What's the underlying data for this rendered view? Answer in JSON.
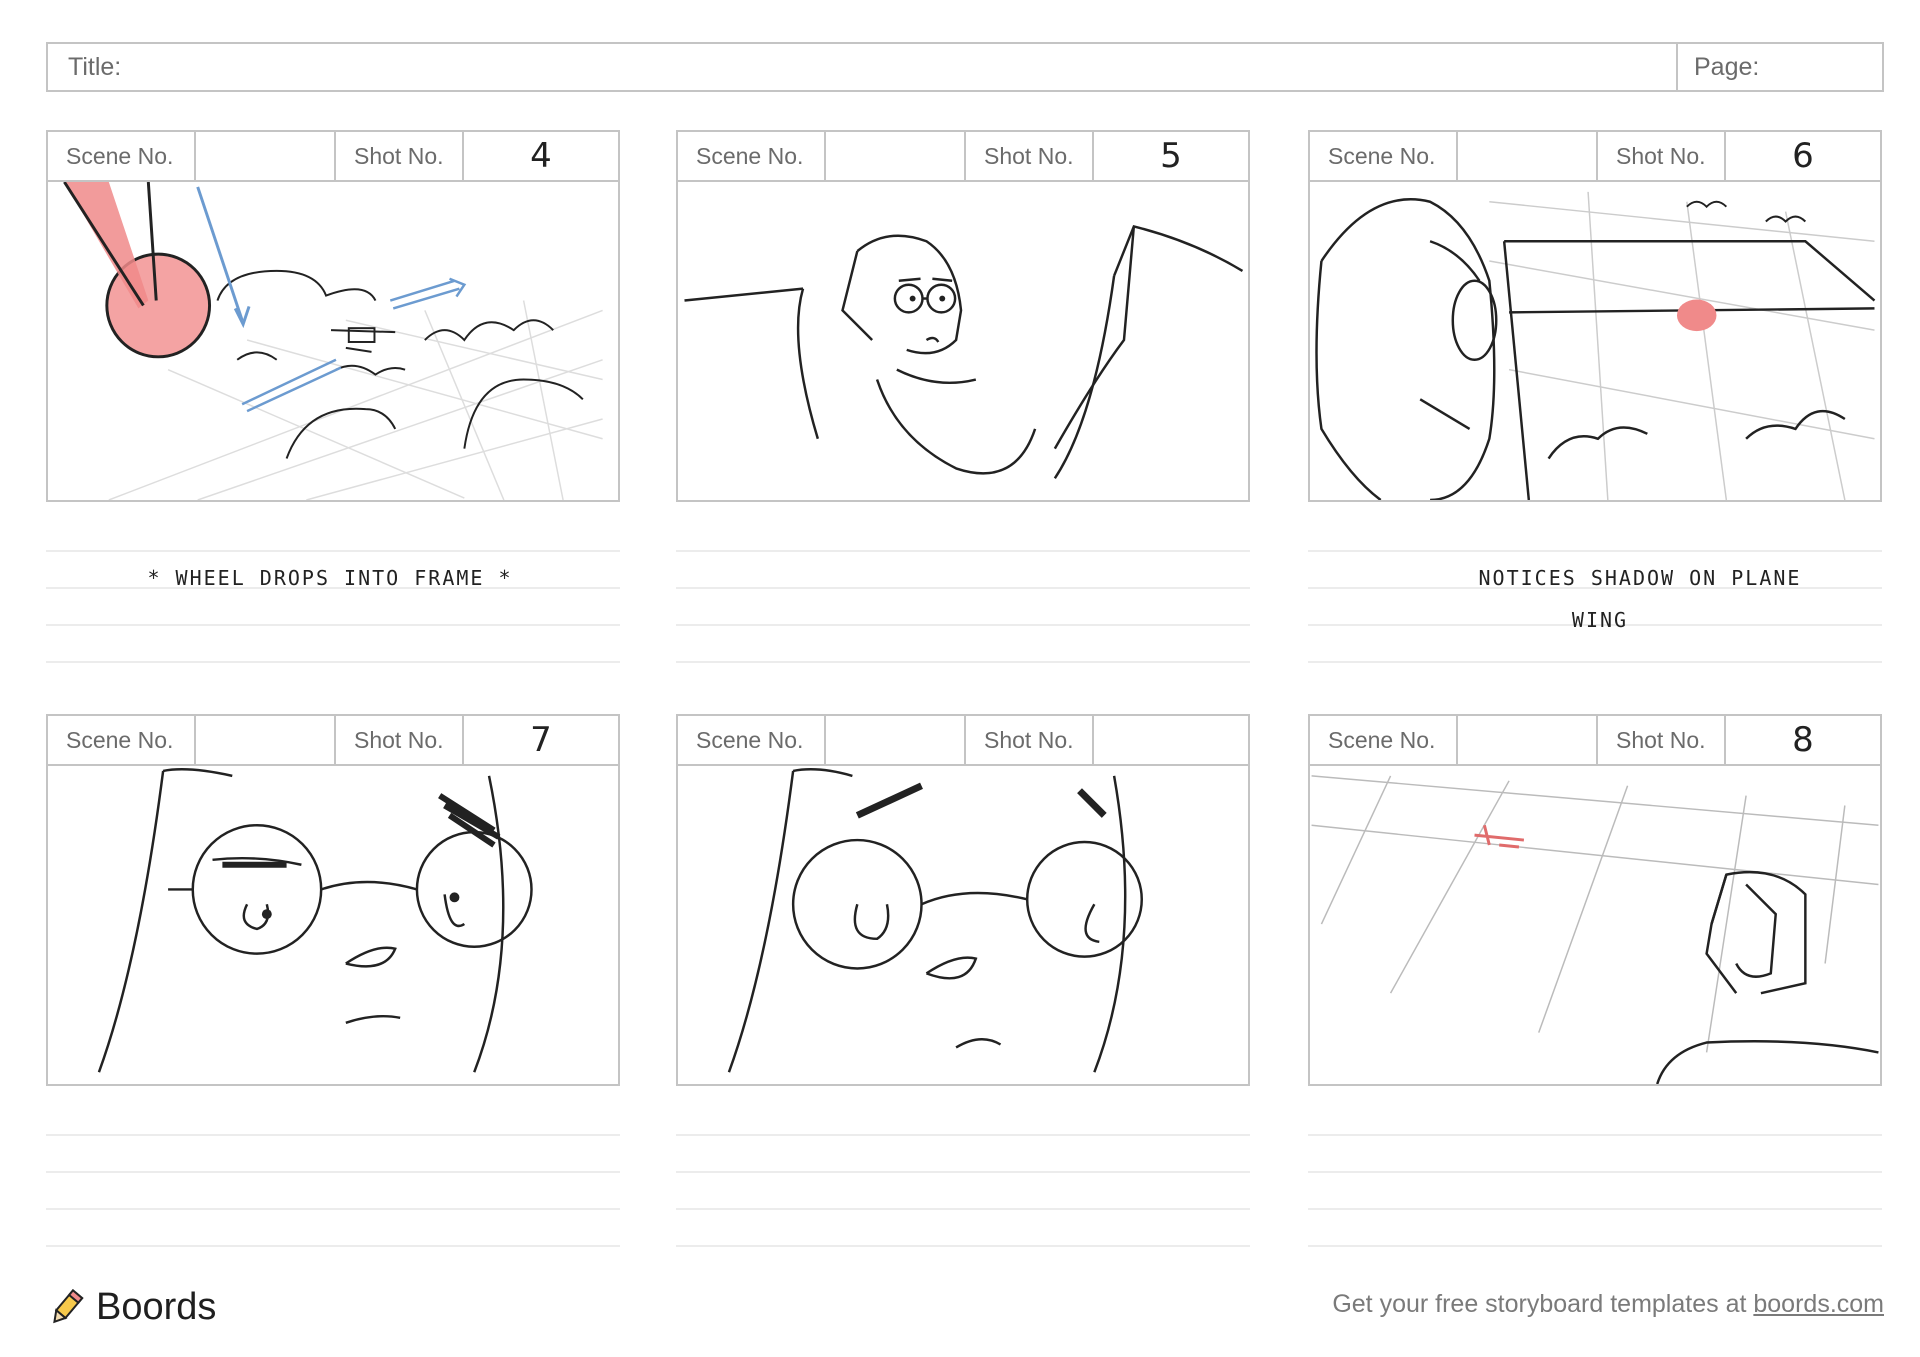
{
  "header": {
    "title_label": "Title:",
    "page_label": "Page:"
  },
  "panels": [
    {
      "scene_label": "Scene No.",
      "scene_value": "",
      "shot_label": "Shot No.",
      "shot_value": "4"
    },
    {
      "scene_label": "Scene No.",
      "scene_value": "",
      "shot_label": "Shot No.",
      "shot_value": "5"
    },
    {
      "scene_label": "Scene No.",
      "scene_value": "",
      "shot_label": "Shot No.",
      "shot_value": "6"
    },
    {
      "scene_label": "Scene No.",
      "scene_value": "",
      "shot_label": "Shot No.",
      "shot_value": "7"
    },
    {
      "scene_label": "Scene No.",
      "scene_value": "",
      "shot_label": "Shot No.",
      "shot_value": ""
    },
    {
      "scene_label": "Scene No.",
      "scene_value": "",
      "shot_label": "Shot No.",
      "shot_value": "8"
    }
  ],
  "notes": {
    "panel1": "* WHEEL DROPS INTO FRAME *",
    "panel3_line1": "NOTICES SHADOW ON PLANE",
    "panel3_line2": "WING"
  },
  "footer": {
    "brand": "Boords",
    "cta_text": "Get your free storyboard templates at ",
    "cta_link": "boords.com"
  },
  "colors": {
    "accent_red": "#f08a8a",
    "accent_blue": "#6c9bd0",
    "border": "#c4c4c4"
  },
  "icons": [
    "pencil-logo-icon"
  ]
}
